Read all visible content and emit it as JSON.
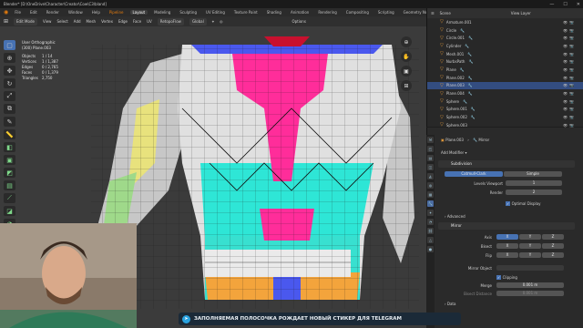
{
  "window": {
    "title": "Blender* [D:\\OneDrive\\Character\\Creator\\Cow\\C3\\bland]",
    "controls": [
      "—",
      "☐",
      "✕"
    ]
  },
  "menubar": {
    "items": [
      "File",
      "Edit",
      "Render",
      "Window",
      "Help"
    ],
    "workspaces": [
      "Pipeline",
      "Layout",
      "Modeling",
      "Sculpting",
      "UV Editing",
      "Texture Paint",
      "Shading",
      "Animation",
      "Rendering",
      "Compositing",
      "Scripting",
      "Geometry Nodes"
    ],
    "active_workspace": "Layout"
  },
  "viewport_header": {
    "mode": "Edit Mode",
    "menus": [
      "View",
      "Select",
      "Add",
      "Mesh",
      "Vertex",
      "Edge",
      "Face",
      "UV"
    ],
    "transform": "RetopoFlow",
    "orientation": "Global",
    "options": "Options"
  },
  "viewport_stats": {
    "view": "User Orthographic",
    "object": "(300) Plane.003",
    "lines": [
      {
        "label": "Objects",
        "value": "1 / 14"
      },
      {
        "label": "Vertices",
        "value": "1 / 1,387"
      },
      {
        "label": "Edges",
        "value": "0 / 2,765"
      },
      {
        "label": "Faces",
        "value": "0 / 1,379"
      },
      {
        "label": "Triangles",
        "value": "2,750"
      }
    ]
  },
  "toolbar": {
    "tools": [
      "select-box-icon",
      "cursor-icon",
      "move-icon",
      "rotate-icon",
      "scale-icon",
      "transform-icon",
      "annotate-icon",
      "measure-icon",
      "extrude-icon",
      "inset-icon",
      "bevel-icon",
      "loopcut-icon",
      "knife-icon",
      "polybuild-icon",
      "spin-icon",
      "smooth-icon",
      "shear-icon",
      "rip-icon"
    ]
  },
  "outliner": {
    "title": "Scene",
    "view_layer": "View Layer",
    "rows": [
      {
        "name": "Armature.001",
        "has_mod": false,
        "selected": false
      },
      {
        "name": "Circle",
        "has_mod": true,
        "selected": false
      },
      {
        "name": "Circle.001",
        "has_mod": true,
        "selected": false
      },
      {
        "name": "Cylinder",
        "has_mod": true,
        "selected": false
      },
      {
        "name": "Mesh.001",
        "has_mod": true,
        "selected": false
      },
      {
        "name": "NurbsPath",
        "has_mod": true,
        "selected": false
      },
      {
        "name": "Plane",
        "has_mod": true,
        "selected": false
      },
      {
        "name": "Plane.002",
        "has_mod": true,
        "selected": false
      },
      {
        "name": "Plane.003",
        "has_mod": true,
        "selected": true
      },
      {
        "name": "Plane.004",
        "has_mod": true,
        "selected": false
      },
      {
        "name": "Sphere",
        "has_mod": true,
        "selected": false
      },
      {
        "name": "Sphere.001",
        "has_mod": true,
        "selected": false
      },
      {
        "name": "Sphere.002",
        "has_mod": true,
        "selected": false
      },
      {
        "name": "Sphere.003",
        "has_mod": false,
        "selected": false
      }
    ]
  },
  "properties": {
    "object_name": "Plane.003",
    "modifier_tab": "Mirror",
    "add_modifier": "Add Modifier",
    "subdivision": {
      "name": "Subdivision",
      "modes": [
        "Catmull-Clark",
        "Simple"
      ],
      "levels_viewport_label": "Levels Viewport",
      "levels_viewport": "1",
      "render_label": "Render",
      "render": "2",
      "optimal_display": "Optimal Display",
      "advanced": "Advanced"
    },
    "mirror": {
      "name": "Mirror",
      "axis_label": "Axis",
      "bisect_label": "Bisect",
      "flip_label": "Flip",
      "axes": [
        "X",
        "Y",
        "Z"
      ],
      "mirror_object_label": "Mirror Object",
      "clipping": "Clipping",
      "merge_label": "Merge",
      "merge_value": "0.001 m",
      "bisect_distance_label": "Bisect Distance",
      "bisect_distance_value": "0.001 m",
      "data": "Data"
    }
  },
  "banner": {
    "text": "ЗАПОЛНЯЕМАЯ ПОЛОСОЧКА РОЖДАЕТ НОВЫЙ СТИКЕР ДЛЯ TELEGRAM"
  },
  "colors": {
    "accent": "#4772b3",
    "select": "#334d80",
    "mesh_pink": "#ff2d9a",
    "mesh_teal": "#2ee6d6",
    "mesh_yellow": "#f0e86a",
    "mesh_green": "#7fd98a",
    "mesh_blue": "#4a58ee"
  }
}
